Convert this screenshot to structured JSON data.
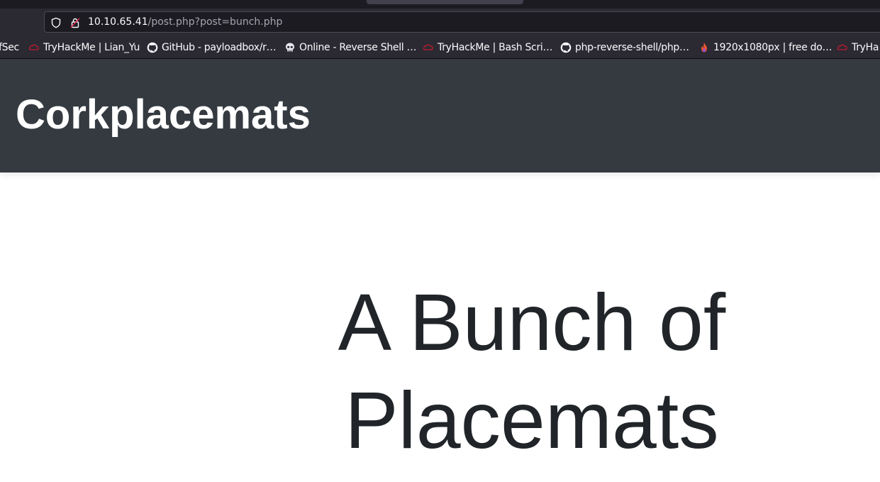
{
  "browser": {
    "url_host": "10.10.65.41",
    "url_path": "/post.php?post=bunch.php",
    "bookmarks": [
      {
        "label": "fSec",
        "icon": "none"
      },
      {
        "label": "TryHackMe | Lian_Yu",
        "icon": "tryhackme-icon"
      },
      {
        "label": "GitHub - payloadbox/r…",
        "icon": "github-icon"
      },
      {
        "label": "Online - Reverse Shell …",
        "icon": "skull-icon"
      },
      {
        "label": "TryHackMe | Bash Scri…",
        "icon": "tryhackme-icon"
      },
      {
        "label": "php-reverse-shell/php…",
        "icon": "github-icon"
      },
      {
        "label": "1920x1080px | free do…",
        "icon": "flame-icon"
      },
      {
        "label": "TryHa",
        "icon": "tryhackme-icon"
      }
    ]
  },
  "site": {
    "brand": "Corkplacemats",
    "post_title": "A Bunch of Placemats"
  },
  "colors": {
    "header_bg": "#343a40",
    "title_text": "#212529",
    "browser_toolbar": "#2b2a33"
  }
}
